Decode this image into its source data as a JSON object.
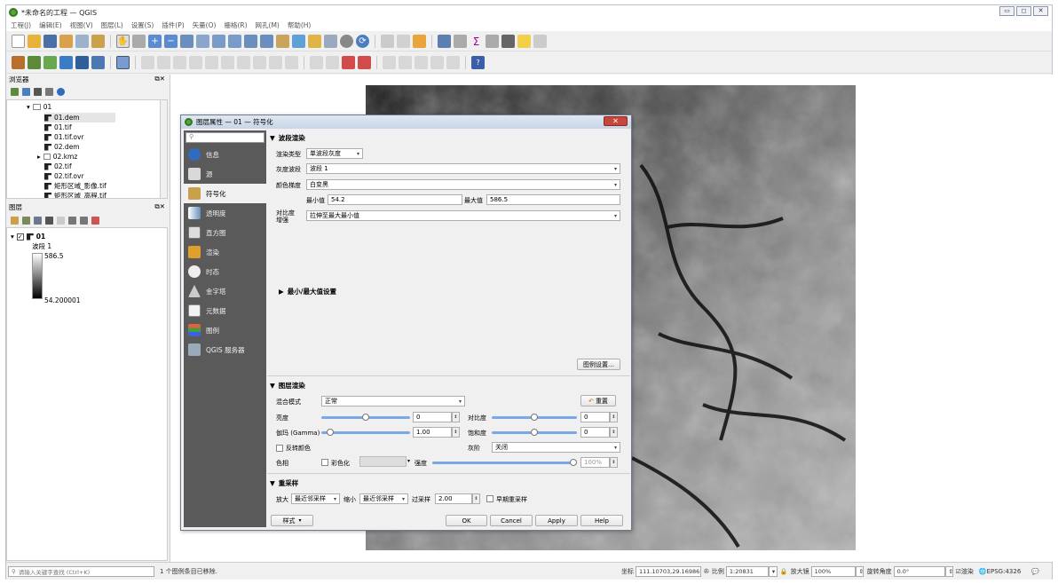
{
  "window": {
    "title": "*未命名的工程 — QGIS",
    "buttons": [
      "▭",
      "◻",
      "✕"
    ]
  },
  "menu": [
    "工程(J)",
    "编辑(E)",
    "视图(V)",
    "图层(L)",
    "设置(S)",
    "插件(P)",
    "矢量(O)",
    "栅格(R)",
    "网孔(M)",
    "帮助(H)"
  ],
  "browser": {
    "title": "浏览器",
    "folder": "01",
    "items": [
      "01.dem",
      "01.tif",
      "01.tif.ovr",
      "02.dem",
      "02.kmz",
      "02.tif",
      "02.tif.ovr",
      "矩形区域_影像.tif",
      "矩形区域_高程.tif"
    ]
  },
  "layers": {
    "title": "图层",
    "layer_name": "01",
    "band": "波段 1",
    "max": "586.5",
    "min": "54.200001"
  },
  "dialog": {
    "title": "图层属性 — 01 — 符号化",
    "nav": [
      "信息",
      "源",
      "符号化",
      "透明度",
      "直方图",
      "渲染",
      "时态",
      "金字塔",
      "元数据",
      "图例",
      "QGIS 服务器"
    ],
    "band_rendering": {
      "section": "波段渲染",
      "render_type_label": "渲染类型",
      "render_type": "单波段灰度",
      "gray_band_label": "灰度波段",
      "gray_band": "波段 1",
      "color_gradient_label": "颜色梯度",
      "color_gradient": "白变黑",
      "min_label": "最小值",
      "min": "54.2",
      "max_label": "最大值",
      "max": "586.5",
      "contrast_label_1": "对比度",
      "contrast_label_2": "增强",
      "contrast": "拉伸至最大最小值",
      "minmax_settings": "最小/最大值设置",
      "style_settings": "图例设置…"
    },
    "layer_rendering": {
      "section": "图层渲染",
      "blend_label": "混合模式",
      "blend": "正常",
      "reset": "重置",
      "brightness_label": "亮度",
      "brightness": "0",
      "contrast_label": "对比度",
      "contrast": "0",
      "gamma_label": "伽玛 (Gamma)",
      "gamma": "1.00",
      "saturation_label": "饱和度",
      "saturation": "0",
      "invert_label": "反转颜色",
      "grayscale_label": "灰阶",
      "grayscale": "关闭",
      "hue_label": "色相",
      "colorize_label": "彩色化",
      "strength_label": "强度",
      "strength": "100%"
    },
    "resampling": {
      "section": "重采样",
      "zoomin_label": "放大",
      "zoomin": "最近邻采样",
      "zoomout_label": "缩小",
      "zoomout": "最近邻采样",
      "oversampling_label": "过采样",
      "oversampling": "2.00",
      "early_label": "早期重采样"
    },
    "footer": {
      "style": "样式",
      "ok": "OK",
      "cancel": "Cancel",
      "apply": "Apply",
      "help": "Help"
    }
  },
  "status": {
    "search_placeholder": "请输入关键字查找 (Ctrl+K)",
    "message": "1 个图例条目已移除.",
    "coord_label": "坐标",
    "coord": "111.10703,29.16986",
    "scale_label": "比例",
    "scale": "1:20831",
    "magnifier_label": "放大镜",
    "magnifier": "100%",
    "rotation_label": "旋转角度",
    "rotation": "0.0°",
    "render_label": "渲染",
    "crs": "EPSG:4326"
  }
}
